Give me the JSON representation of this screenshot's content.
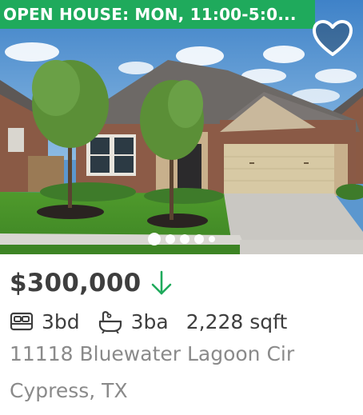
{
  "listing": {
    "open_house_banner": "OPEN HOUSE: MON, 11:00-5:0...",
    "favorite_icon": "heart-outline-icon",
    "photo_count": 5,
    "active_photo": 1,
    "price": "$300,000",
    "price_trend_icon": "arrow-down-icon",
    "price_trend_color": "#1faa5c",
    "beds": "3bd",
    "beds_icon": "bed-icon",
    "baths": "3ba",
    "baths_icon": "bathtub-icon",
    "sqft": "2,228 sqft",
    "address_line1": "11118 Bluewater Lagoon Cir",
    "address_line2": "Cypress, TX"
  },
  "colors": {
    "banner": "#1faa5c",
    "text_primary": "#3e3e3e",
    "text_secondary": "#8a8a8a"
  }
}
